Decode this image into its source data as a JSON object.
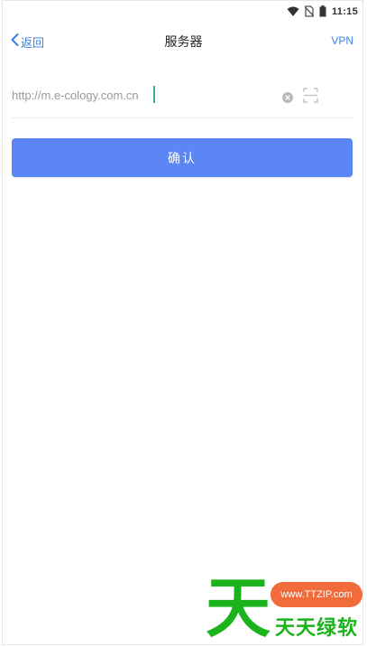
{
  "status_bar": {
    "time": "11:15",
    "icons": [
      "wifi-icon",
      "no-sim-icon",
      "battery-icon"
    ]
  },
  "nav": {
    "back_label": "返回",
    "title": "服务器",
    "vpn_label": "VPN"
  },
  "server_form": {
    "url_value": "http://m.e-cology.com.cn",
    "confirm_label": "确认"
  },
  "watermark": {
    "big_char": "天",
    "site": "www.TTZIP.com",
    "name": "天天绿软"
  },
  "colors": {
    "accent": "#3c82e6",
    "button": "#5b86f4",
    "watermark_green": "#1bb31b",
    "watermark_orange": "#f26b3a"
  }
}
